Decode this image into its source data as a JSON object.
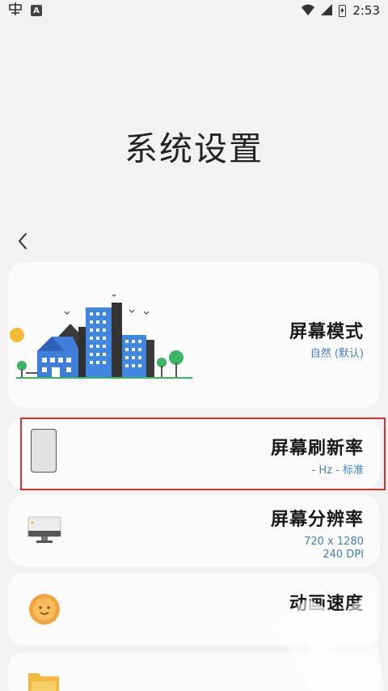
{
  "status_bar": {
    "time": "2:53",
    "left_icons": [
      "app-notification-icon",
      "a-notification-icon"
    ],
    "right_icons": [
      "wifi-icon",
      "signal-icon",
      "battery-icon"
    ]
  },
  "page": {
    "title": "系统设置"
  },
  "settings": [
    {
      "title": "屏幕模式",
      "subtitle": "自然 (默认)",
      "icon": "city-illustration"
    },
    {
      "title": "屏幕刷新率",
      "subtitle": "- Hz - 标准",
      "icon": "phone-icon",
      "highlighted": true
    },
    {
      "title": "屏幕分辨率",
      "subtitle_line1": "720 x 1280",
      "subtitle_line2": "240 DPI",
      "icon": "monitor-icon"
    },
    {
      "title": "动画速度",
      "icon": "sun-icon"
    },
    {
      "icon": "folder-icon"
    }
  ],
  "colors": {
    "accent_blue": "#3f7fc4",
    "highlight_red": "#d3322f",
    "background": "#f2f2f2",
    "card": "#fbfbfb"
  }
}
